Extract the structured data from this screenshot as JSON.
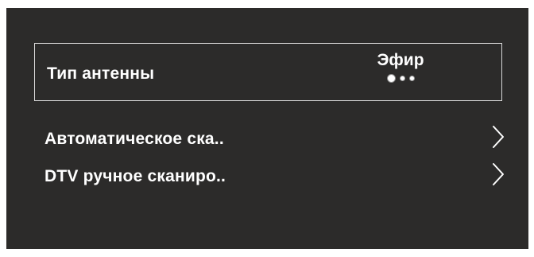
{
  "antenna": {
    "label": "Тип антенны",
    "value": "Эфир",
    "options_count": 3,
    "selected_index": 0
  },
  "menu": {
    "items": [
      {
        "label": "Автоматическое ска..",
        "icon": "chevron-right-icon"
      },
      {
        "label": "DTV ручное сканиро..",
        "icon": "chevron-right-icon"
      }
    ]
  },
  "colors": {
    "background": "#2c2b2a",
    "text": "#ffffff",
    "focus_border": "#d8d8d8"
  }
}
